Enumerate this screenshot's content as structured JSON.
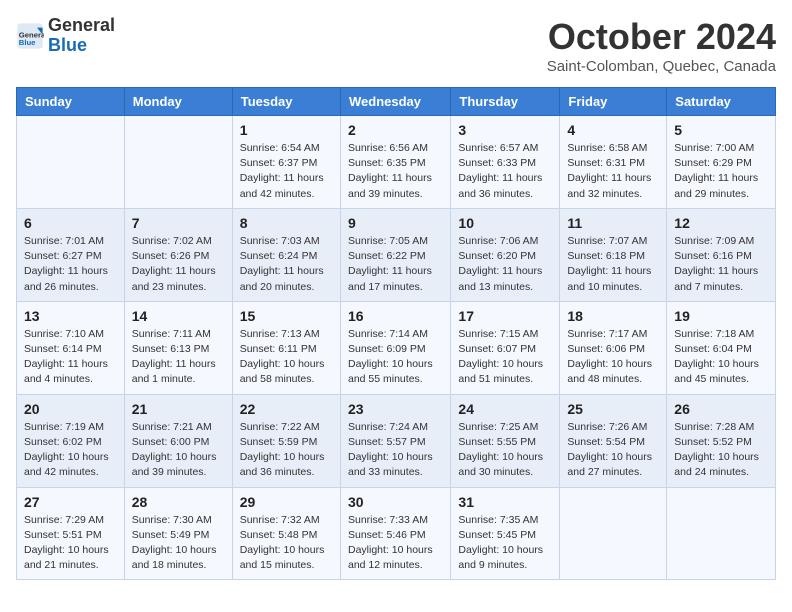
{
  "header": {
    "logo_general": "General",
    "logo_blue": "Blue",
    "title": "October 2024",
    "subtitle": "Saint-Colomban, Quebec, Canada"
  },
  "days_of_week": [
    "Sunday",
    "Monday",
    "Tuesday",
    "Wednesday",
    "Thursday",
    "Friday",
    "Saturday"
  ],
  "weeks": [
    [
      {
        "day": "",
        "info": ""
      },
      {
        "day": "",
        "info": ""
      },
      {
        "day": "1",
        "info": "Sunrise: 6:54 AM\nSunset: 6:37 PM\nDaylight: 11 hours and 42 minutes."
      },
      {
        "day": "2",
        "info": "Sunrise: 6:56 AM\nSunset: 6:35 PM\nDaylight: 11 hours and 39 minutes."
      },
      {
        "day": "3",
        "info": "Sunrise: 6:57 AM\nSunset: 6:33 PM\nDaylight: 11 hours and 36 minutes."
      },
      {
        "day": "4",
        "info": "Sunrise: 6:58 AM\nSunset: 6:31 PM\nDaylight: 11 hours and 32 minutes."
      },
      {
        "day": "5",
        "info": "Sunrise: 7:00 AM\nSunset: 6:29 PM\nDaylight: 11 hours and 29 minutes."
      }
    ],
    [
      {
        "day": "6",
        "info": "Sunrise: 7:01 AM\nSunset: 6:27 PM\nDaylight: 11 hours and 26 minutes."
      },
      {
        "day": "7",
        "info": "Sunrise: 7:02 AM\nSunset: 6:26 PM\nDaylight: 11 hours and 23 minutes."
      },
      {
        "day": "8",
        "info": "Sunrise: 7:03 AM\nSunset: 6:24 PM\nDaylight: 11 hours and 20 minutes."
      },
      {
        "day": "9",
        "info": "Sunrise: 7:05 AM\nSunset: 6:22 PM\nDaylight: 11 hours and 17 minutes."
      },
      {
        "day": "10",
        "info": "Sunrise: 7:06 AM\nSunset: 6:20 PM\nDaylight: 11 hours and 13 minutes."
      },
      {
        "day": "11",
        "info": "Sunrise: 7:07 AM\nSunset: 6:18 PM\nDaylight: 11 hours and 10 minutes."
      },
      {
        "day": "12",
        "info": "Sunrise: 7:09 AM\nSunset: 6:16 PM\nDaylight: 11 hours and 7 minutes."
      }
    ],
    [
      {
        "day": "13",
        "info": "Sunrise: 7:10 AM\nSunset: 6:14 PM\nDaylight: 11 hours and 4 minutes."
      },
      {
        "day": "14",
        "info": "Sunrise: 7:11 AM\nSunset: 6:13 PM\nDaylight: 11 hours and 1 minute."
      },
      {
        "day": "15",
        "info": "Sunrise: 7:13 AM\nSunset: 6:11 PM\nDaylight: 10 hours and 58 minutes."
      },
      {
        "day": "16",
        "info": "Sunrise: 7:14 AM\nSunset: 6:09 PM\nDaylight: 10 hours and 55 minutes."
      },
      {
        "day": "17",
        "info": "Sunrise: 7:15 AM\nSunset: 6:07 PM\nDaylight: 10 hours and 51 minutes."
      },
      {
        "day": "18",
        "info": "Sunrise: 7:17 AM\nSunset: 6:06 PM\nDaylight: 10 hours and 48 minutes."
      },
      {
        "day": "19",
        "info": "Sunrise: 7:18 AM\nSunset: 6:04 PM\nDaylight: 10 hours and 45 minutes."
      }
    ],
    [
      {
        "day": "20",
        "info": "Sunrise: 7:19 AM\nSunset: 6:02 PM\nDaylight: 10 hours and 42 minutes."
      },
      {
        "day": "21",
        "info": "Sunrise: 7:21 AM\nSunset: 6:00 PM\nDaylight: 10 hours and 39 minutes."
      },
      {
        "day": "22",
        "info": "Sunrise: 7:22 AM\nSunset: 5:59 PM\nDaylight: 10 hours and 36 minutes."
      },
      {
        "day": "23",
        "info": "Sunrise: 7:24 AM\nSunset: 5:57 PM\nDaylight: 10 hours and 33 minutes."
      },
      {
        "day": "24",
        "info": "Sunrise: 7:25 AM\nSunset: 5:55 PM\nDaylight: 10 hours and 30 minutes."
      },
      {
        "day": "25",
        "info": "Sunrise: 7:26 AM\nSunset: 5:54 PM\nDaylight: 10 hours and 27 minutes."
      },
      {
        "day": "26",
        "info": "Sunrise: 7:28 AM\nSunset: 5:52 PM\nDaylight: 10 hours and 24 minutes."
      }
    ],
    [
      {
        "day": "27",
        "info": "Sunrise: 7:29 AM\nSunset: 5:51 PM\nDaylight: 10 hours and 21 minutes."
      },
      {
        "day": "28",
        "info": "Sunrise: 7:30 AM\nSunset: 5:49 PM\nDaylight: 10 hours and 18 minutes."
      },
      {
        "day": "29",
        "info": "Sunrise: 7:32 AM\nSunset: 5:48 PM\nDaylight: 10 hours and 15 minutes."
      },
      {
        "day": "30",
        "info": "Sunrise: 7:33 AM\nSunset: 5:46 PM\nDaylight: 10 hours and 12 minutes."
      },
      {
        "day": "31",
        "info": "Sunrise: 7:35 AM\nSunset: 5:45 PM\nDaylight: 10 hours and 9 minutes."
      },
      {
        "day": "",
        "info": ""
      },
      {
        "day": "",
        "info": ""
      }
    ]
  ]
}
